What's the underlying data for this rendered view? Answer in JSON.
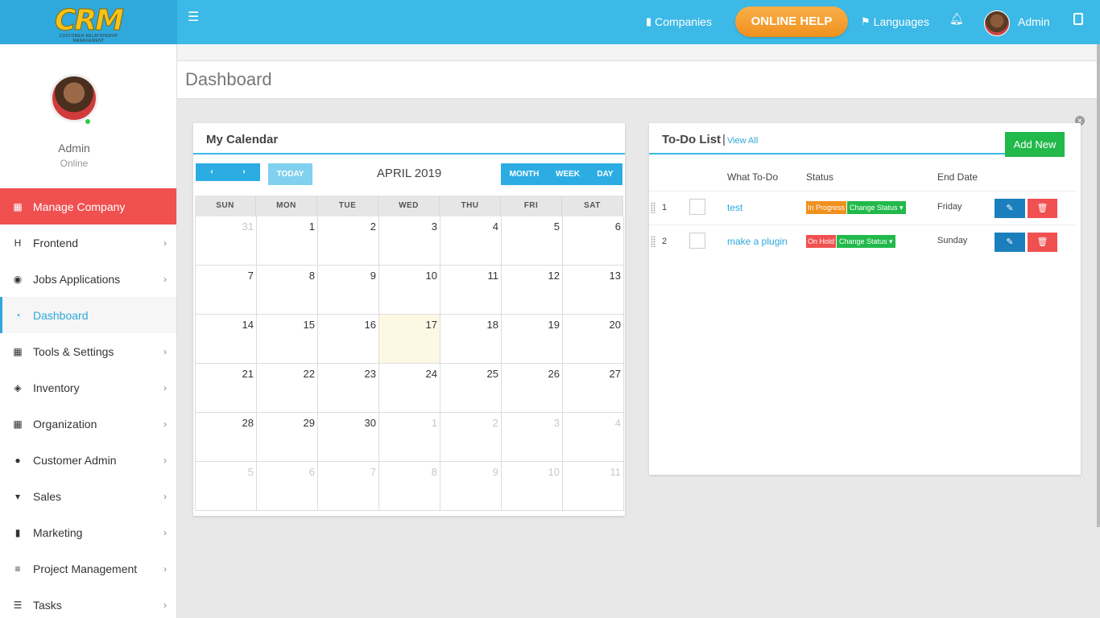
{
  "brand": {
    "logo_text": "CRM",
    "logo_sub": "CUSTOMER RELATIONSHIP MANAGEMENT"
  },
  "topbar": {
    "companies": "Companies",
    "online_help": "ONLINE HELP",
    "languages": "Languages",
    "admin": "Admin"
  },
  "profile": {
    "name": "Admin",
    "status": "Online"
  },
  "sidebar": {
    "items": [
      {
        "label": "Manage Company",
        "icon": "building-icon",
        "chevron": false
      },
      {
        "label": "Frontend",
        "icon": "h-square-icon",
        "chevron": true
      },
      {
        "label": "Jobs Applications",
        "icon": "compass-icon",
        "chevron": true
      },
      {
        "label": "Dashboard",
        "icon": "dashboard-icon",
        "chevron": false
      },
      {
        "label": "Tools & Settings",
        "icon": "building-icon",
        "chevron": true
      },
      {
        "label": "Inventory",
        "icon": "cube-icon",
        "chevron": true
      },
      {
        "label": "Organization",
        "icon": "building-icon",
        "chevron": true
      },
      {
        "label": "Customer Admin",
        "icon": "user-icon",
        "chevron": true
      },
      {
        "label": "Sales",
        "icon": "cart-icon",
        "chevron": true
      },
      {
        "label": "Marketing",
        "icon": "bookmark-icon",
        "chevron": true
      },
      {
        "label": "Project Management",
        "icon": "list-icon",
        "chevron": true
      },
      {
        "label": "Tasks",
        "icon": "tasks-icon",
        "chevron": true
      }
    ]
  },
  "page": {
    "title": "Dashboard"
  },
  "calendar": {
    "title": "My Calendar",
    "today_label": "TODAY",
    "month_label": "APRIL 2019",
    "views": [
      "MONTH",
      "WEEK",
      "DAY"
    ],
    "weekdays": [
      "SUN",
      "MON",
      "TUE",
      "WED",
      "THU",
      "FRI",
      "SAT"
    ],
    "weeks": [
      [
        "31",
        "1",
        "2",
        "3",
        "4",
        "5",
        "6"
      ],
      [
        "7",
        "8",
        "9",
        "10",
        "11",
        "12",
        "13"
      ],
      [
        "14",
        "15",
        "16",
        "17",
        "18",
        "19",
        "20"
      ],
      [
        "21",
        "22",
        "23",
        "24",
        "25",
        "26",
        "27"
      ],
      [
        "28",
        "29",
        "30",
        "1",
        "2",
        "3",
        "4"
      ],
      [
        "5",
        "6",
        "7",
        "8",
        "9",
        "10",
        "11"
      ]
    ],
    "today": "17"
  },
  "todo": {
    "title": "To-Do List",
    "separator": "|",
    "view_all": "View All",
    "add_new": "Add New",
    "columns": {
      "what": "What To-Do",
      "status": "Status",
      "end_date": "End Date"
    },
    "change_status": "Change Status",
    "rows": [
      {
        "num": "1",
        "task": "test",
        "status": "In Progress",
        "status_color": "#f0901d",
        "end_date": "Friday"
      },
      {
        "num": "2",
        "task": "make a plugin",
        "status": "On Hold",
        "status_color": "#f05050",
        "end_date": "Sunday"
      }
    ]
  },
  "colors": {
    "accent": "#3cb9e6",
    "danger": "#f05050",
    "success": "#21b94a",
    "warning": "#f0901d"
  }
}
